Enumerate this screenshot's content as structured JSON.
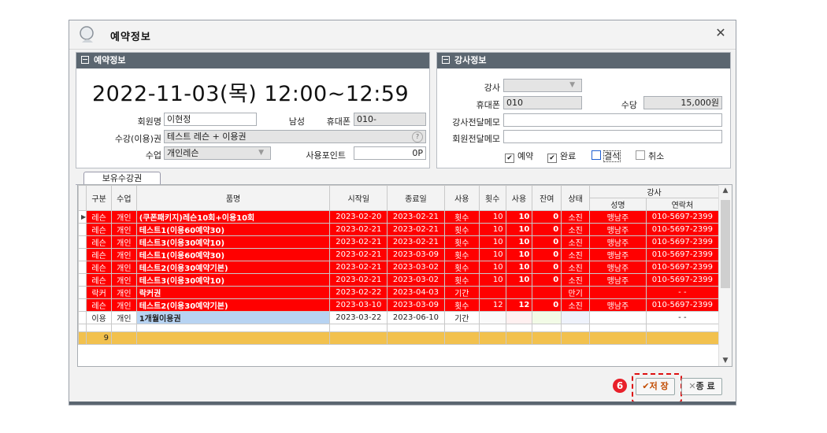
{
  "window": {
    "title": "예약정보"
  },
  "reservation": {
    "header": "예약정보",
    "datetime": "2022-11-03(목) 12:00~12:59",
    "member_label": "회원명",
    "member_value": "이현정",
    "gender": "남성",
    "phone_label": "휴대폰",
    "phone_value": "010-",
    "pass_label": "수강(이용)권",
    "pass_value": "테스트 레슨 + 이용권",
    "class_label": "수업",
    "class_value": "개인레슨",
    "points_label": "사용포인트",
    "points_value": "0P"
  },
  "instructor": {
    "header": "강사정보",
    "name_label": "강사",
    "name_value": "",
    "phone_label": "휴대폰",
    "phone_value": "010",
    "fee_label": "수당",
    "fee_value": "15,000원",
    "memo1_label": "강사전달메모",
    "memo2_label": "회원전달메모",
    "status": [
      {
        "label": "예약",
        "checked": true
      },
      {
        "label": "완료",
        "checked": true
      },
      {
        "label": "결석",
        "checked": false
      },
      {
        "label": "취소",
        "checked": false
      }
    ]
  },
  "tab": {
    "label": "보유수강권"
  },
  "grid": {
    "headers": {
      "kind": "구분",
      "class": "수업",
      "name": "품명",
      "start": "시작일",
      "end": "종료일",
      "use": "사용",
      "count": "횟수",
      "used": "사용",
      "remain": "잔여",
      "state": "상태",
      "instructor": "강사",
      "inst_name": "성명",
      "inst_phone": "연락처"
    },
    "rows": [
      {
        "kind": "레슨",
        "class": "개인",
        "name": "(쿠폰패키지)레슨10회+이용10회",
        "start": "2023-02-20",
        "end": "2023-02-21",
        "use": "횟수",
        "count": "10",
        "used": "10",
        "remain": "0",
        "state": "소진",
        "inst": "맹남주",
        "phone": "010-5697-2399"
      },
      {
        "kind": "레슨",
        "class": "개인",
        "name": "테스트1(이용60예약30)",
        "start": "2023-02-21",
        "end": "2023-02-21",
        "use": "횟수",
        "count": "10",
        "used": "10",
        "remain": "0",
        "state": "소진",
        "inst": "맹남주",
        "phone": "010-5697-2399"
      },
      {
        "kind": "레슨",
        "class": "개인",
        "name": "테스트3(이용30예약10)",
        "start": "2023-02-21",
        "end": "2023-02-21",
        "use": "횟수",
        "count": "10",
        "used": "10",
        "remain": "0",
        "state": "소진",
        "inst": "맹남주",
        "phone": "010-5697-2399"
      },
      {
        "kind": "레슨",
        "class": "개인",
        "name": "테스트1(이용60예약30)",
        "start": "2023-02-21",
        "end": "2023-03-09",
        "use": "횟수",
        "count": "10",
        "used": "10",
        "remain": "0",
        "state": "소진",
        "inst": "맹남주",
        "phone": "010-5697-2399"
      },
      {
        "kind": "레슨",
        "class": "개인",
        "name": "테스트2(이용30예약기본)",
        "start": "2023-02-21",
        "end": "2023-03-02",
        "use": "횟수",
        "count": "10",
        "used": "10",
        "remain": "0",
        "state": "소진",
        "inst": "맹남주",
        "phone": "010-5697-2399"
      },
      {
        "kind": "레슨",
        "class": "개인",
        "name": "테스트3(이용30예약10)",
        "start": "2023-02-21",
        "end": "2023-03-02",
        "use": "횟수",
        "count": "10",
        "used": "10",
        "remain": "0",
        "state": "소진",
        "inst": "맹남주",
        "phone": "010-5697-2399"
      },
      {
        "kind": "락커",
        "class": "개인",
        "name": "락커권",
        "start": "2023-02-22",
        "end": "2023-04-03",
        "use": "기간",
        "count": "",
        "used": "",
        "remain": "",
        "state": "만기",
        "inst": "",
        "phone": "-   -"
      },
      {
        "kind": "레슨",
        "class": "개인",
        "name": "테스트2(이용30예약기본)",
        "start": "2023-03-10",
        "end": "2023-03-09",
        "use": "횟수",
        "count": "12",
        "used": "12",
        "remain": "0",
        "state": "소진",
        "inst": "맹남주",
        "phone": "010-5697-2399"
      },
      {
        "kind": "이용",
        "class": "개인",
        "name": "1개월이용권",
        "start": "2023-03-22",
        "end": "2023-06-10",
        "use": "기간",
        "count": "",
        "used": "",
        "remain": "",
        "state": "",
        "inst": "",
        "phone": "-   -"
      }
    ],
    "footer_count": "9"
  },
  "buttons": {
    "save": "저 장",
    "close": "종 료",
    "badge": "6"
  },
  "colors": {
    "highlight": "#ff0000",
    "header_bar": "#5b6670",
    "total_row": "#f2c14e"
  }
}
